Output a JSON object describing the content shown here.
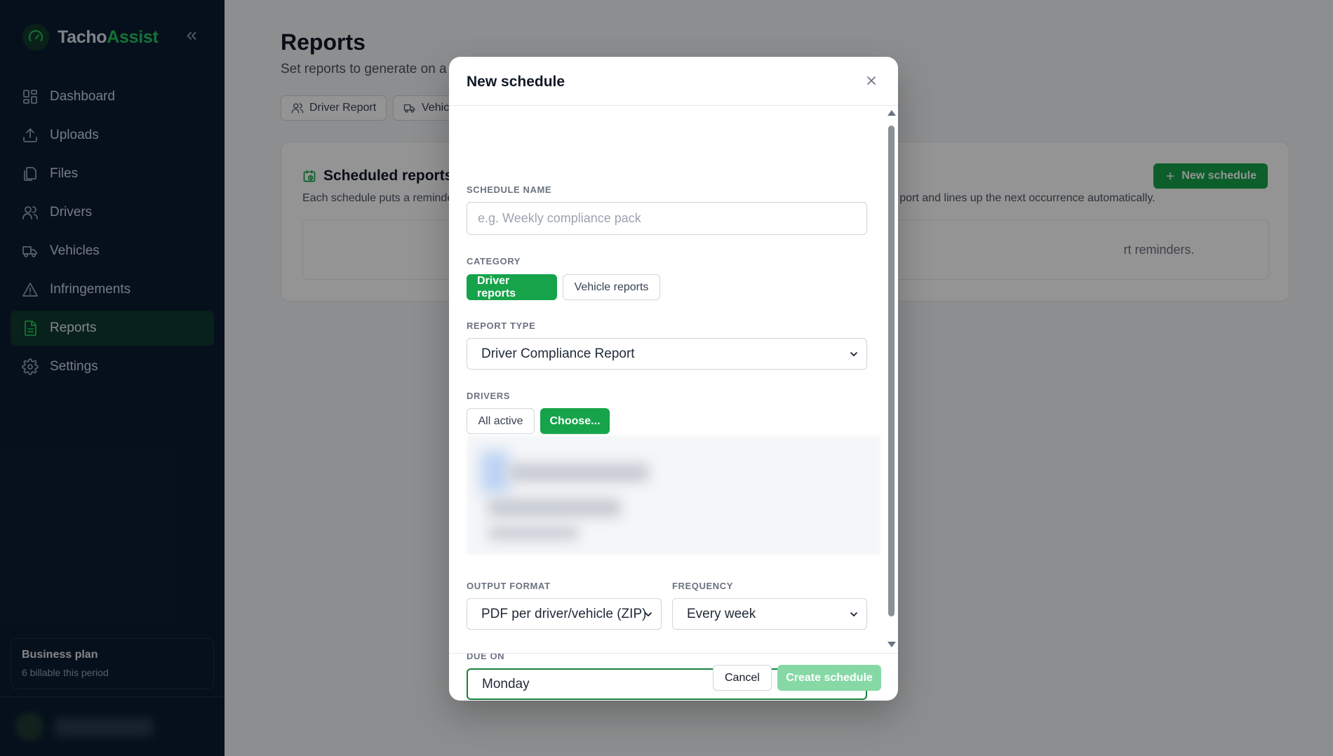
{
  "brand": {
    "name_part1": "Tacho",
    "name_part2": "Assist"
  },
  "colors": {
    "brand_green": "#16a34a",
    "sidebar_bg": "#0b1d31",
    "active_nav_bg": "#0f3a2e"
  },
  "sidebar": {
    "items": [
      {
        "label": "Dashboard",
        "icon": "grid-icon"
      },
      {
        "label": "Uploads",
        "icon": "upload-icon"
      },
      {
        "label": "Files",
        "icon": "files-icon"
      },
      {
        "label": "Drivers",
        "icon": "users-icon"
      },
      {
        "label": "Vehicles",
        "icon": "truck-icon"
      },
      {
        "label": "Infringements",
        "icon": "warning-icon"
      },
      {
        "label": "Reports",
        "icon": "report-icon",
        "active": true
      },
      {
        "label": "Settings",
        "icon": "gear-icon"
      }
    ],
    "plan": {
      "title": "Business plan",
      "subtitle": "6 billable this period"
    }
  },
  "page": {
    "title": "Reports",
    "subtitle": "Set reports to generate on a r",
    "tabs": [
      {
        "label": "Driver Report",
        "icon": "users-icon"
      },
      {
        "label": "Vehic",
        "icon": "truck-icon"
      }
    ],
    "scheduled": {
      "title": "Scheduled reports",
      "desc_left": "Each schedule puts a reminde",
      "desc_right": "port and lines up the next occurrence automatically.",
      "new_button": "New schedule",
      "empty_text": "rt reminders."
    }
  },
  "modal": {
    "title": "New schedule",
    "schedule_name": {
      "label": "SCHEDULE NAME",
      "placeholder": "e.g. Weekly compliance pack",
      "value": ""
    },
    "category": {
      "label": "CATEGORY",
      "options": [
        "Driver reports",
        "Vehicle reports"
      ],
      "selected": "Driver reports"
    },
    "report_type": {
      "label": "REPORT TYPE",
      "value": "Driver Compliance Report"
    },
    "drivers": {
      "label": "DRIVERS",
      "options": [
        "All active",
        "Choose..."
      ],
      "selected": "Choose..."
    },
    "output_format": {
      "label": "OUTPUT FORMAT",
      "value": "PDF per driver/vehicle (ZIP)"
    },
    "frequency": {
      "label": "FREQUENCY",
      "value": "Every week"
    },
    "due_on": {
      "label": "DUE ON",
      "value": "Monday"
    },
    "cancel_label": "Cancel",
    "create_label": "Create schedule"
  }
}
